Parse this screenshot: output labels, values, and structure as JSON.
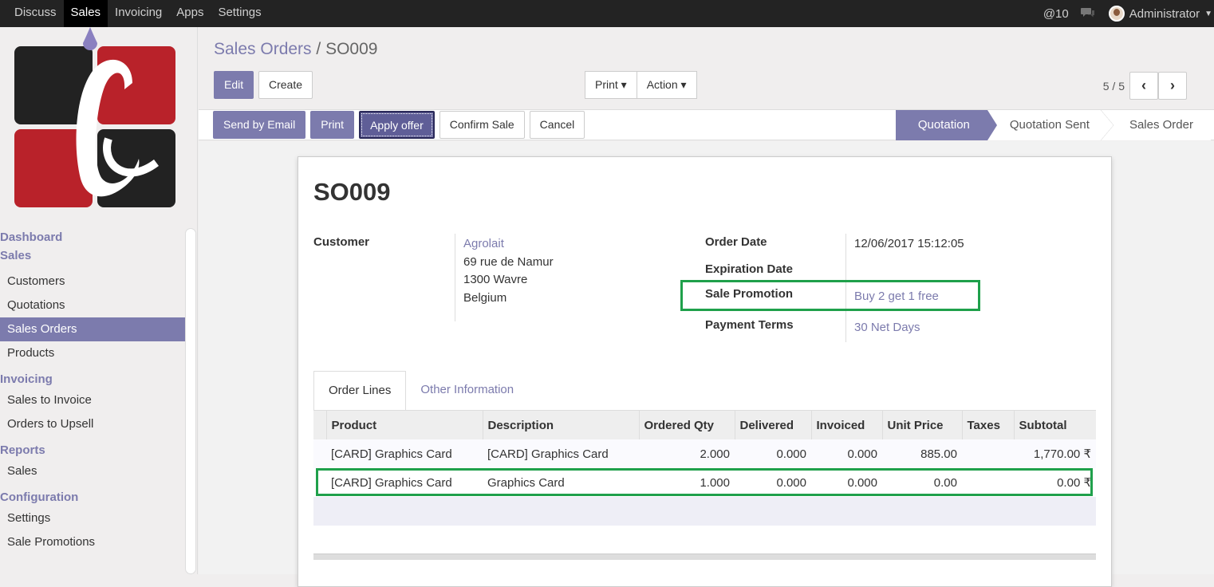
{
  "topbar": {
    "menu": [
      "Discuss",
      "Sales",
      "Invoicing",
      "Apps",
      "Settings"
    ],
    "messages": "@10",
    "user": "Administrator"
  },
  "sidebar": {
    "sections": [
      {
        "label": "Dashboard",
        "items": []
      },
      {
        "label": "Sales",
        "items": [
          "Customers",
          "Quotations",
          "Sales Orders",
          "Products"
        ]
      },
      {
        "label": "Invoicing",
        "items": [
          "Sales to Invoice",
          "Orders to Upsell"
        ]
      },
      {
        "label": "Reports",
        "items": [
          "Sales"
        ]
      },
      {
        "label": "Configuration",
        "items": [
          "Settings",
          "Sale Promotions"
        ]
      }
    ],
    "active_item": "Sales Orders"
  },
  "breadcrumb": {
    "parent": "Sales Orders",
    "sep": "/",
    "current": "SO009"
  },
  "control": {
    "edit": "Edit",
    "create": "Create",
    "print": "Print",
    "action": "Action",
    "pager": "5 / 5"
  },
  "status": {
    "buttons": [
      "Send by Email",
      "Print",
      "Apply offer",
      "Confirm Sale",
      "Cancel"
    ],
    "stages": [
      "Quotation",
      "Quotation Sent",
      "Sales Order"
    ],
    "current_stage": "Quotation"
  },
  "order": {
    "name": "SO009",
    "customer_label": "Customer",
    "customer": "Agrolait",
    "address": [
      "69 rue de Namur",
      "1300 Wavre",
      "Belgium"
    ],
    "order_date_label": "Order Date",
    "order_date": "12/06/2017 15:12:05",
    "expiration_label": "Expiration Date",
    "promotion_label": "Sale Promotion",
    "promotion": "Buy 2 get 1 free",
    "payment_label": "Payment Terms",
    "payment": "30 Net Days"
  },
  "tabs": [
    "Order Lines",
    "Other Information"
  ],
  "lines": {
    "columns": [
      "Product",
      "Description",
      "Ordered Qty",
      "Delivered",
      "Invoiced",
      "Unit Price",
      "Taxes",
      "Subtotal"
    ],
    "rows": [
      [
        "[CARD] Graphics Card",
        "[CARD] Graphics Card",
        "2.000",
        "0.000",
        "0.000",
        "885.00",
        "",
        "1,770.00 ₹"
      ],
      [
        "[CARD] Graphics Card",
        "Graphics Card",
        "1.000",
        "0.000",
        "0.000",
        "0.00",
        "",
        "0.00 ₹"
      ]
    ]
  },
  "colors": {
    "accent": "#7c7bad",
    "highlight": "#1fa04b",
    "topbar": "#232323"
  }
}
